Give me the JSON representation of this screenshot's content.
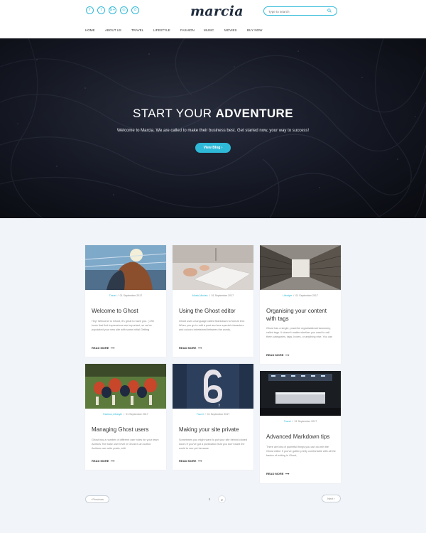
{
  "header": {
    "logo": "marcia",
    "social": [
      "f",
      "t",
      "G+",
      "◎",
      "✆"
    ],
    "search_placeholder": "Type to search",
    "nav": [
      "HOME",
      "ABOUT US",
      "TRAVEL",
      "LIFESTYLE",
      "FASHION",
      "MUSIC",
      "MOVIES",
      "BUY NOW"
    ]
  },
  "hero": {
    "title_light": "START YOUR",
    "title_bold": "ADVENTURE",
    "subtitle": "Welcome to Marcia. We are called to make their business best. Get started now, your way to success!",
    "button": "View Blog  ›"
  },
  "posts": [
    {
      "tag": "Travel",
      "date": "01 September 2017",
      "title": "Welcome to Ghost",
      "excerpt": "Hey! Welcome to Ghost, it's great to have you. :) We know that first impressions are important, so we've populated your new site with some initial Getting",
      "more": "READ MORE"
    },
    {
      "tag": "Music,Movies",
      "date": "01 September 2017",
      "title": "Using the Ghost editor",
      "excerpt": "Ghost uses a language called Markdown to format text. When you go to edit a post and see special characters and colours intertwined between the words,",
      "more": "READ MORE"
    },
    {
      "tag": "Lifestyle",
      "date": "01 September 2017",
      "title": "Organising your content with tags",
      "excerpt": "Ghost has a single, powerful organisational taxonomy, called tags. It doesn't matter whether you want to call them categories, tags, boxes, or anything else. You can",
      "more": "READ MORE"
    },
    {
      "tag": "Fashion,Lifestyle",
      "date": "01 September 2017",
      "title": "Managing Ghost users",
      "excerpt": "Ghost has a number of different user roles for your team Authors The base user level in Ghost is an author. Authors can write posts, edit",
      "more": "READ MORE"
    },
    {
      "tag": "Travel",
      "date": "01 September 2017",
      "title": "Making your site private",
      "excerpt": "Sometimes you might want to put your site behind closed doors If you've got a publication that you don't want the world to see yet because",
      "more": "READ MORE"
    },
    {
      "tag": "Travel",
      "date": "01 September 2017",
      "title": "Advanced Markdown tips",
      "excerpt": "There are lots of powerful things you can do with the Ghost editor If you've gotten pretty comfortable with all the basics of writing in Ghost,",
      "more": "READ MORE"
    }
  ],
  "pagination": {
    "prev": "‹ Previous",
    "next": "Next ›",
    "pages": [
      "1",
      "2"
    ]
  },
  "colors": {
    "accent": "#2fb9d8",
    "logo": "#1e2b3d",
    "page_bg": "#f1f4f8"
  }
}
